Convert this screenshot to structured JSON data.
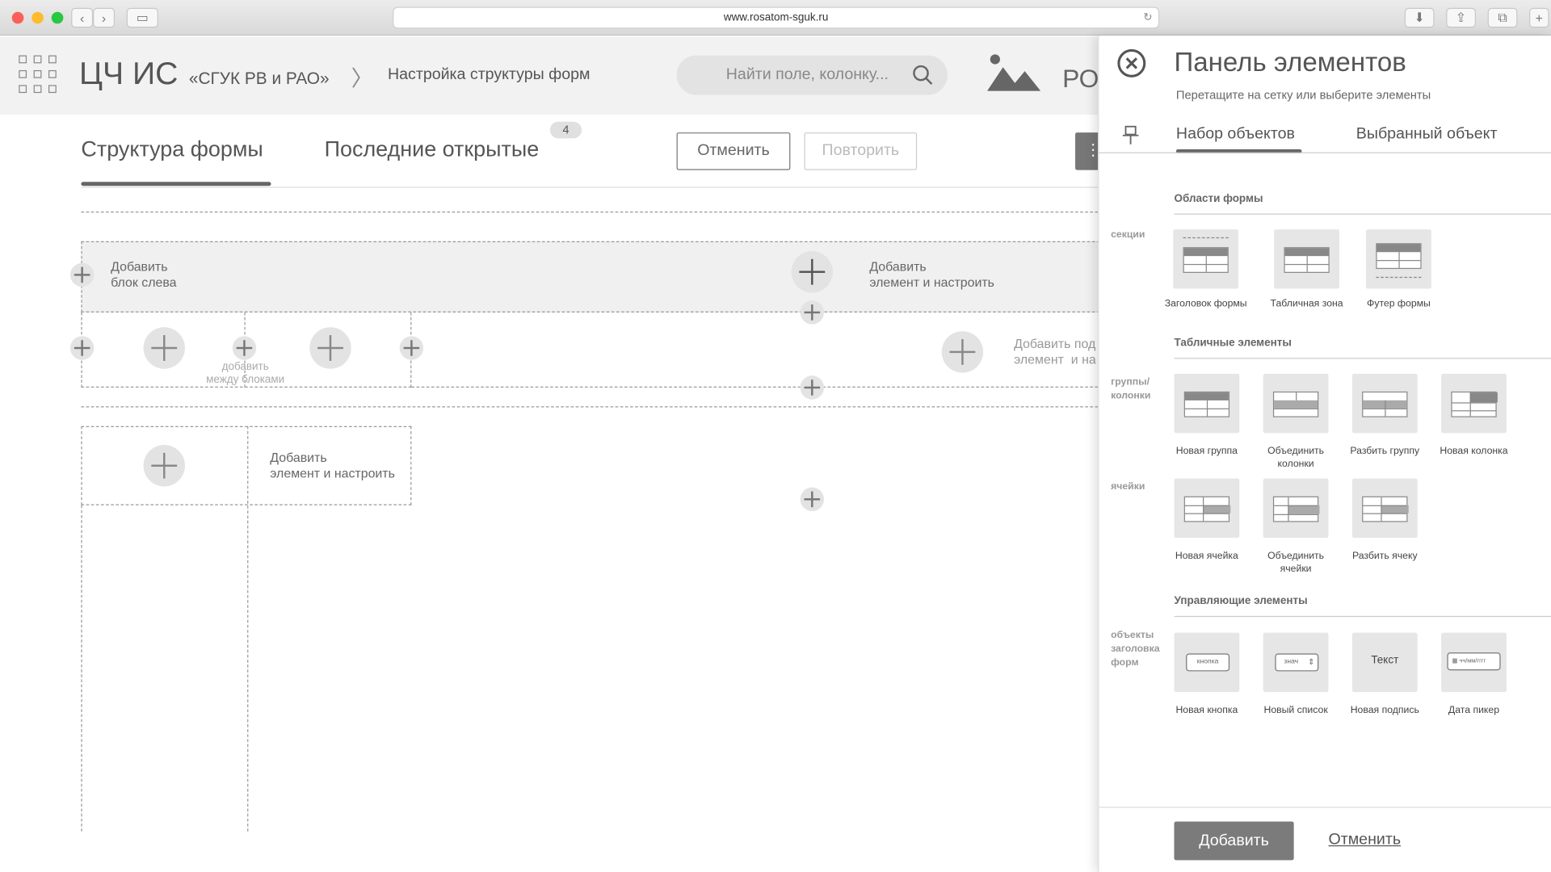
{
  "browser": {
    "url": "www.rosatom-sguk.ru"
  },
  "header": {
    "app_name": "ЦЧ ИС",
    "app_subtitle": "«СГУК РВ и РАО»",
    "breadcrumb": "Настройка структуры форм",
    "search_placeholder": "Найти поле, колонку...",
    "logo_text": "РО"
  },
  "toolbar": {
    "tabs": [
      {
        "label": "Структура формы"
      },
      {
        "label": "Последние открытые",
        "badge": "4"
      }
    ],
    "cancel_label": "Отменить",
    "redo_label": "Повторить"
  },
  "canvas": {
    "add_block_left": "Добавить\nблок слева",
    "add_element_configure": "Добавить\nэлемент и настроить",
    "add_between_blocks": "добавить\nмежду блоками",
    "add_sub_partial": "Добавить под\nэлемент  и на",
    "add_element_configure_2": "Добавить\nэлемент и настроить"
  },
  "panel": {
    "title": "Панель элементов",
    "subtitle": "Перетащите на сетку или выберите элементы",
    "tabs": [
      "Набор объектов",
      "Выбранный объект"
    ],
    "sections": [
      {
        "title": "Области формы",
        "side_label": "секции",
        "items": [
          "Заголовок формы",
          "Табличная зона",
          "Футер формы"
        ]
      },
      {
        "title": "Табличные элементы",
        "side_label": "группы/\nколонки",
        "items": [
          "Новая группа",
          "Объединить\nколонки",
          "Разбить группу",
          "Новая колонка"
        ]
      },
      {
        "side_label": "ячейки",
        "items": [
          "Новая ячейка",
          "Объединить\nячейки",
          "Разбить ячеку"
        ]
      },
      {
        "title": "Управляющие элементы",
        "side_label": "объекты\nзаголовка\nформ",
        "items": [
          "Новая кнопка",
          "Новый список",
          "Новая подпись",
          "Дата пикер"
        ],
        "previews": {
          "button": "кнопка",
          "list": "знач",
          "text": "Текст",
          "date": "чч/мм/гггг"
        }
      }
    ],
    "add_label": "Добавить",
    "cancel_label": "Отменить"
  }
}
